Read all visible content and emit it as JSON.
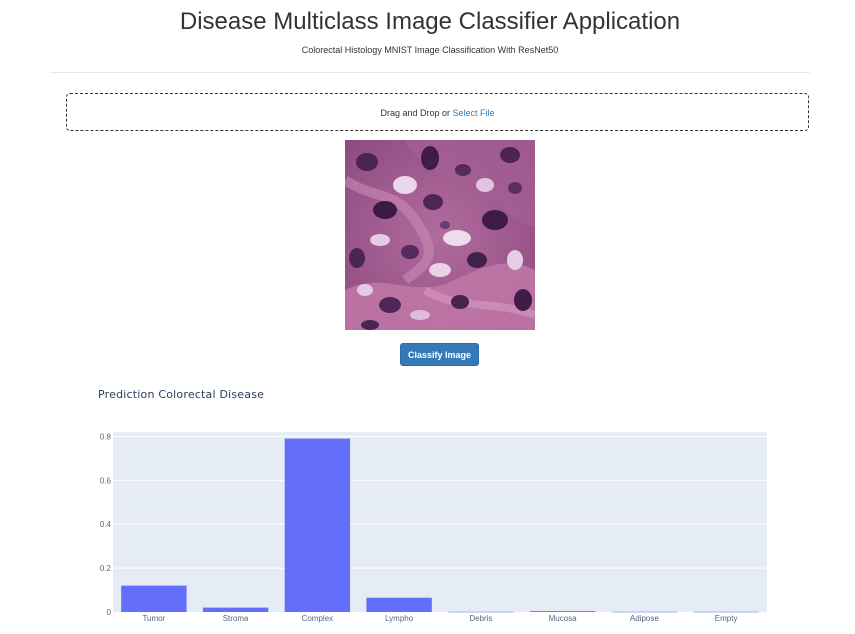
{
  "header": {
    "title": "Disease Multiclass Image Classifier Application",
    "subtitle": "Colorectal Histology MNIST Image Classification With ResNet50"
  },
  "upload": {
    "prompt": "Drag and Drop or ",
    "link_label": "Select File"
  },
  "preview": {
    "description_icon": "histology-image"
  },
  "actions": {
    "classify_label": "Classify Image",
    "button_color": "#337ab7"
  },
  "chart_data": {
    "type": "bar",
    "title": "Prediction Colorectal Disease",
    "categories": [
      "Tumor",
      "Stroma",
      "Complex",
      "Lympho",
      "Debris",
      "Mucosa",
      "Adipose",
      "Empty"
    ],
    "values": [
      0.12,
      0.02,
      0.79,
      0.065,
      0.001,
      0.004,
      0.001,
      0.001
    ],
    "ylim": [
      0,
      0.82
    ],
    "yticks": [
      0,
      0.2,
      0.4,
      0.6,
      0.8
    ],
    "ytick_labels": [
      "0",
      "0.2",
      "0.4",
      "0.6",
      "0.8"
    ],
    "bar_color": "#636efa",
    "background_color": "#e5ecf6",
    "grid": true,
    "xlabel": "",
    "ylabel": ""
  }
}
